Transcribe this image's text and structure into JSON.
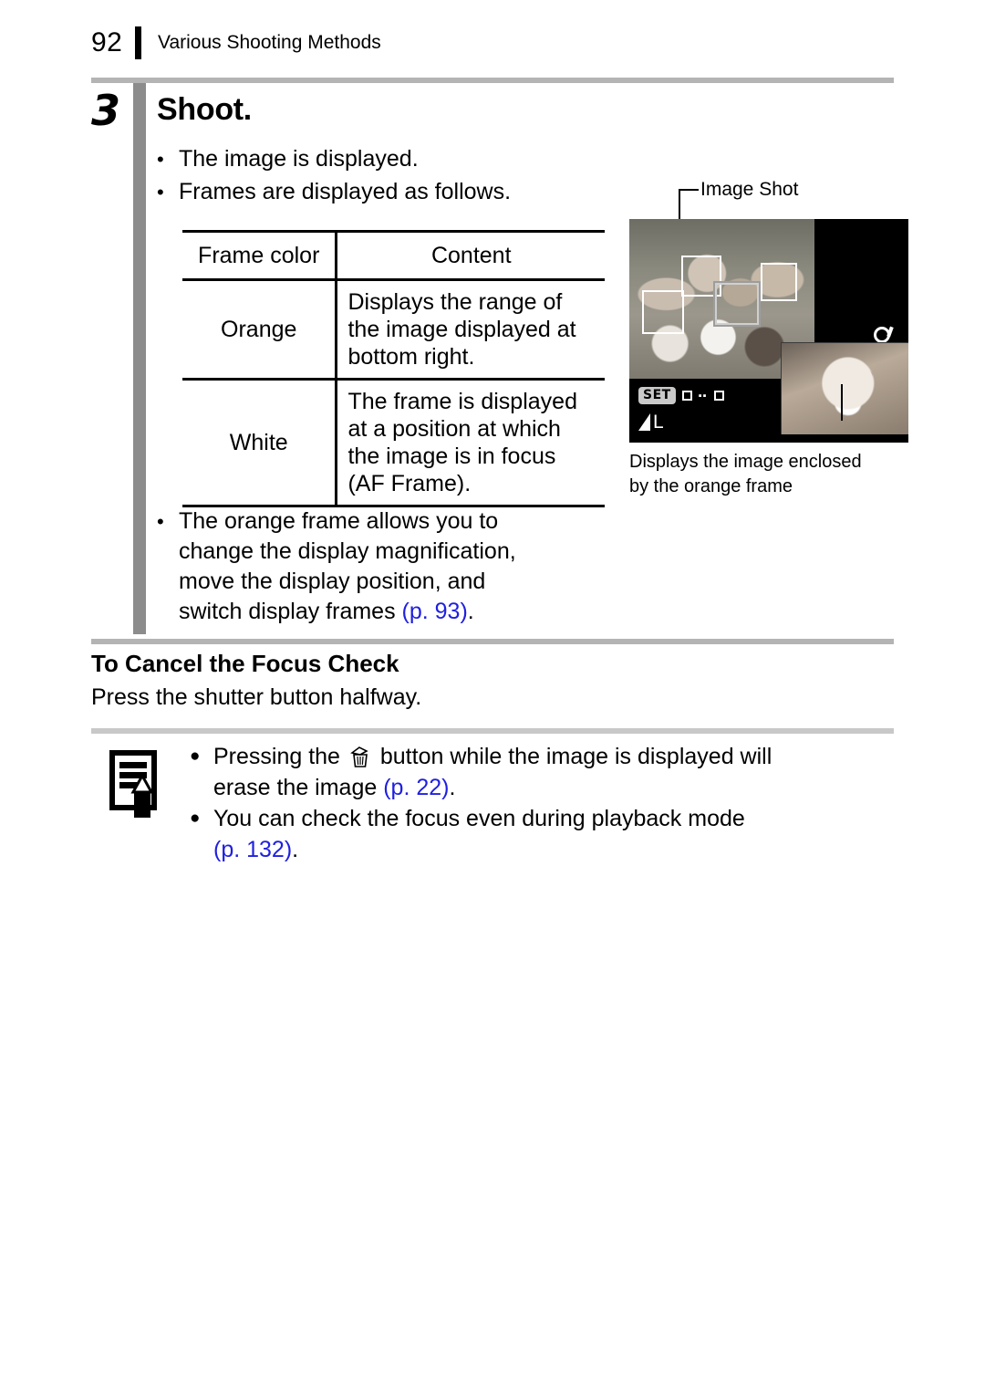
{
  "header": {
    "page_number": "92",
    "title": "Various Shooting Methods"
  },
  "step": {
    "number": "3",
    "title": "Shoot.",
    "bullets": [
      {
        "marker": "•",
        "text": "The image is displayed."
      },
      {
        "marker": "•",
        "text": "Frames are displayed as follows."
      }
    ]
  },
  "table": {
    "headers": [
      "Frame color",
      "Content"
    ],
    "rows": [
      {
        "frame_color": "Orange",
        "content_lines": [
          "Displays the range of",
          "the image displayed at",
          "bottom right."
        ]
      },
      {
        "frame_color": "White",
        "content_lines": [
          "The frame is displayed",
          "at a position at which",
          "the image is in focus",
          "(AF Frame)."
        ]
      }
    ]
  },
  "after_table_bullet": {
    "marker": "•",
    "line1": "The orange frame allows you to",
    "line2": "change the display magnification,",
    "line3": "move the display position, and",
    "line4_pre": "switch display frames ",
    "line4_ref": "(p. 93)",
    "line4_post": "."
  },
  "figure": {
    "callout_label": "Image Shot",
    "caption_line1": "Displays the image enclosed",
    "caption_line2": "by the orange frame",
    "lcd": {
      "set_chip": "SET",
      "arrow_dots": "▪▪",
      "quality_letter": "L",
      "magnifier_icon": "magnifier-icon"
    }
  },
  "cancel_section": {
    "heading": "To Cancel the Focus Check",
    "body": "Press the shutter button halfway."
  },
  "note": {
    "icon_name": "note-pencil-icon",
    "items": [
      {
        "marker": "●",
        "pre_icon": "Pressing the ",
        "icon_name": "erase-trash-icon",
        "post_icon": " button while the image is displayed will",
        "line2_pre": "erase the image ",
        "line2_ref": "(p. 22)",
        "line2_post": "."
      },
      {
        "marker": "●",
        "line1": "You can check the focus even during playback mode",
        "line2_ref": "(p. 132)",
        "line2_post": "."
      }
    ]
  },
  "colors": {
    "page_ref": "#2020e0",
    "step_bar": "#8c8c8c",
    "rule": "#b4b4b4"
  }
}
